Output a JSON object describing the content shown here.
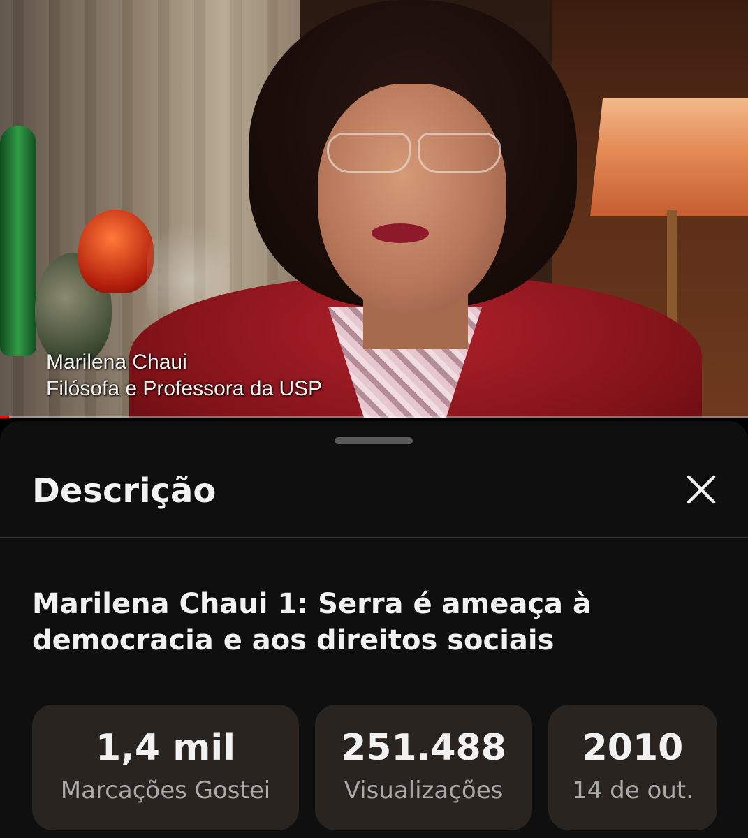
{
  "video": {
    "lower_third": {
      "name": "Marilena Chaui",
      "role": "Filósofa e Professora da USP"
    },
    "progress_fraction": 0.012,
    "progress_color": "#ff0000"
  },
  "description_panel": {
    "title": "Descrição",
    "close_icon": "close-icon",
    "video_title": "Marilena Chaui 1: Serra é ameaça à democracia e aos direitos sociais",
    "stats": {
      "likes": {
        "value": "1,4 mil",
        "label": "Marcações Gostei"
      },
      "views": {
        "value": "251.488",
        "label": "Visualizações"
      },
      "date": {
        "value": "2010",
        "label": "14 de out."
      }
    }
  }
}
